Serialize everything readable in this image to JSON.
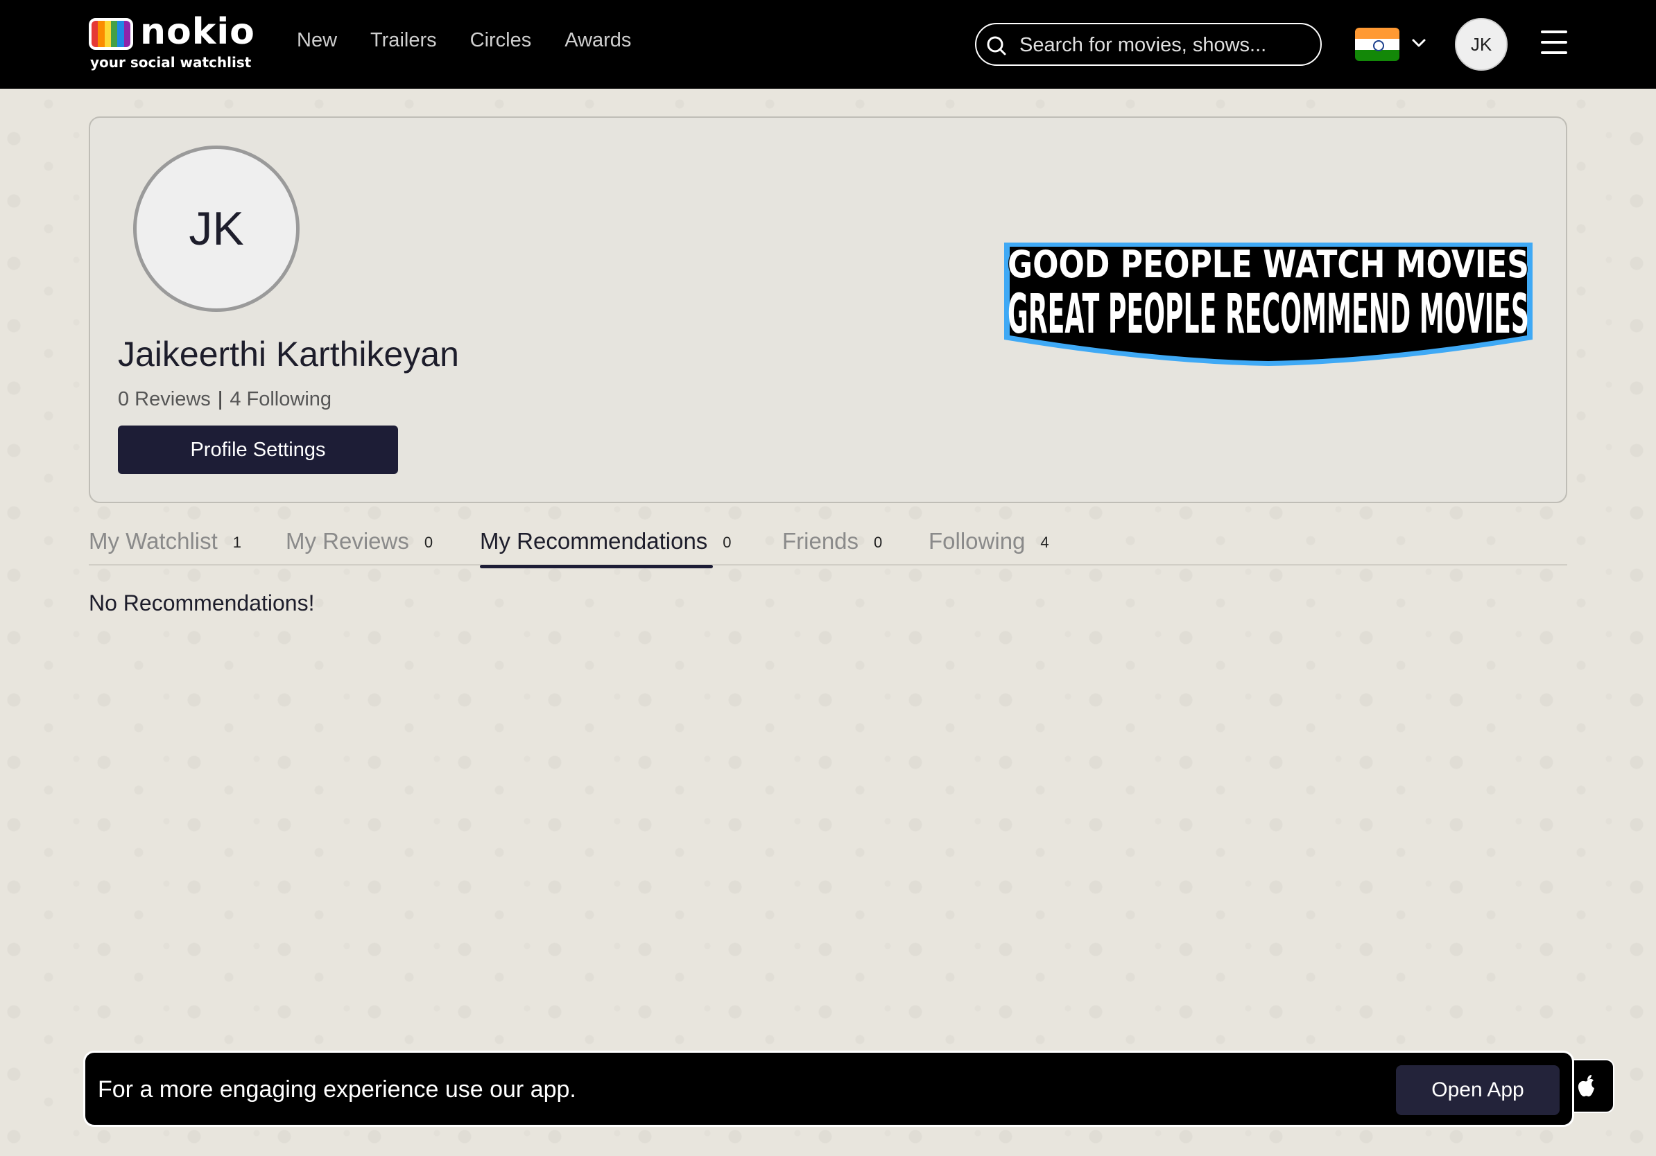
{
  "brand": {
    "name": "nokio",
    "tagline": "your social watchlist",
    "tv_colors": [
      "#e53935",
      "#fb8c00",
      "#fdd835",
      "#43a047",
      "#1e88e5",
      "#8e24aa"
    ]
  },
  "nav": {
    "items": [
      {
        "label": "New"
      },
      {
        "label": "Trailers"
      },
      {
        "label": "Circles"
      },
      {
        "label": "Awards"
      }
    ]
  },
  "search": {
    "placeholder": "Search for movies, shows...",
    "value": ""
  },
  "header": {
    "region_flag": "india-flag-icon",
    "user_initials": "JK"
  },
  "profile": {
    "initials": "JK",
    "name": "Jaikeerthi Karthikeyan",
    "reviews_text": "0 Reviews",
    "following_text": "4 Following",
    "settings_label": "Profile Settings",
    "banner_line1": "GOOD PEOPLE WATCH MOVIES",
    "banner_line2": "GREAT PEOPLE RECOMMEND MOVIES"
  },
  "tabs": [
    {
      "label": "My Watchlist",
      "count": "1",
      "active": false
    },
    {
      "label": "My Reviews",
      "count": "0",
      "active": false
    },
    {
      "label": "My Recommendations",
      "count": "0",
      "active": true
    },
    {
      "label": "Friends",
      "count": "0",
      "active": false
    },
    {
      "label": "Following",
      "count": "4",
      "active": false
    }
  ],
  "content": {
    "empty_message": "No Recommendations!"
  },
  "app_banner": {
    "message": "For a more engaging experience use our app.",
    "button_label": "Open App"
  },
  "colors": {
    "header_bg": "#000000",
    "accent_dark": "#1d1d36",
    "page_bg": "#e8e5dd",
    "banner_blue": "#3fa9f5"
  }
}
